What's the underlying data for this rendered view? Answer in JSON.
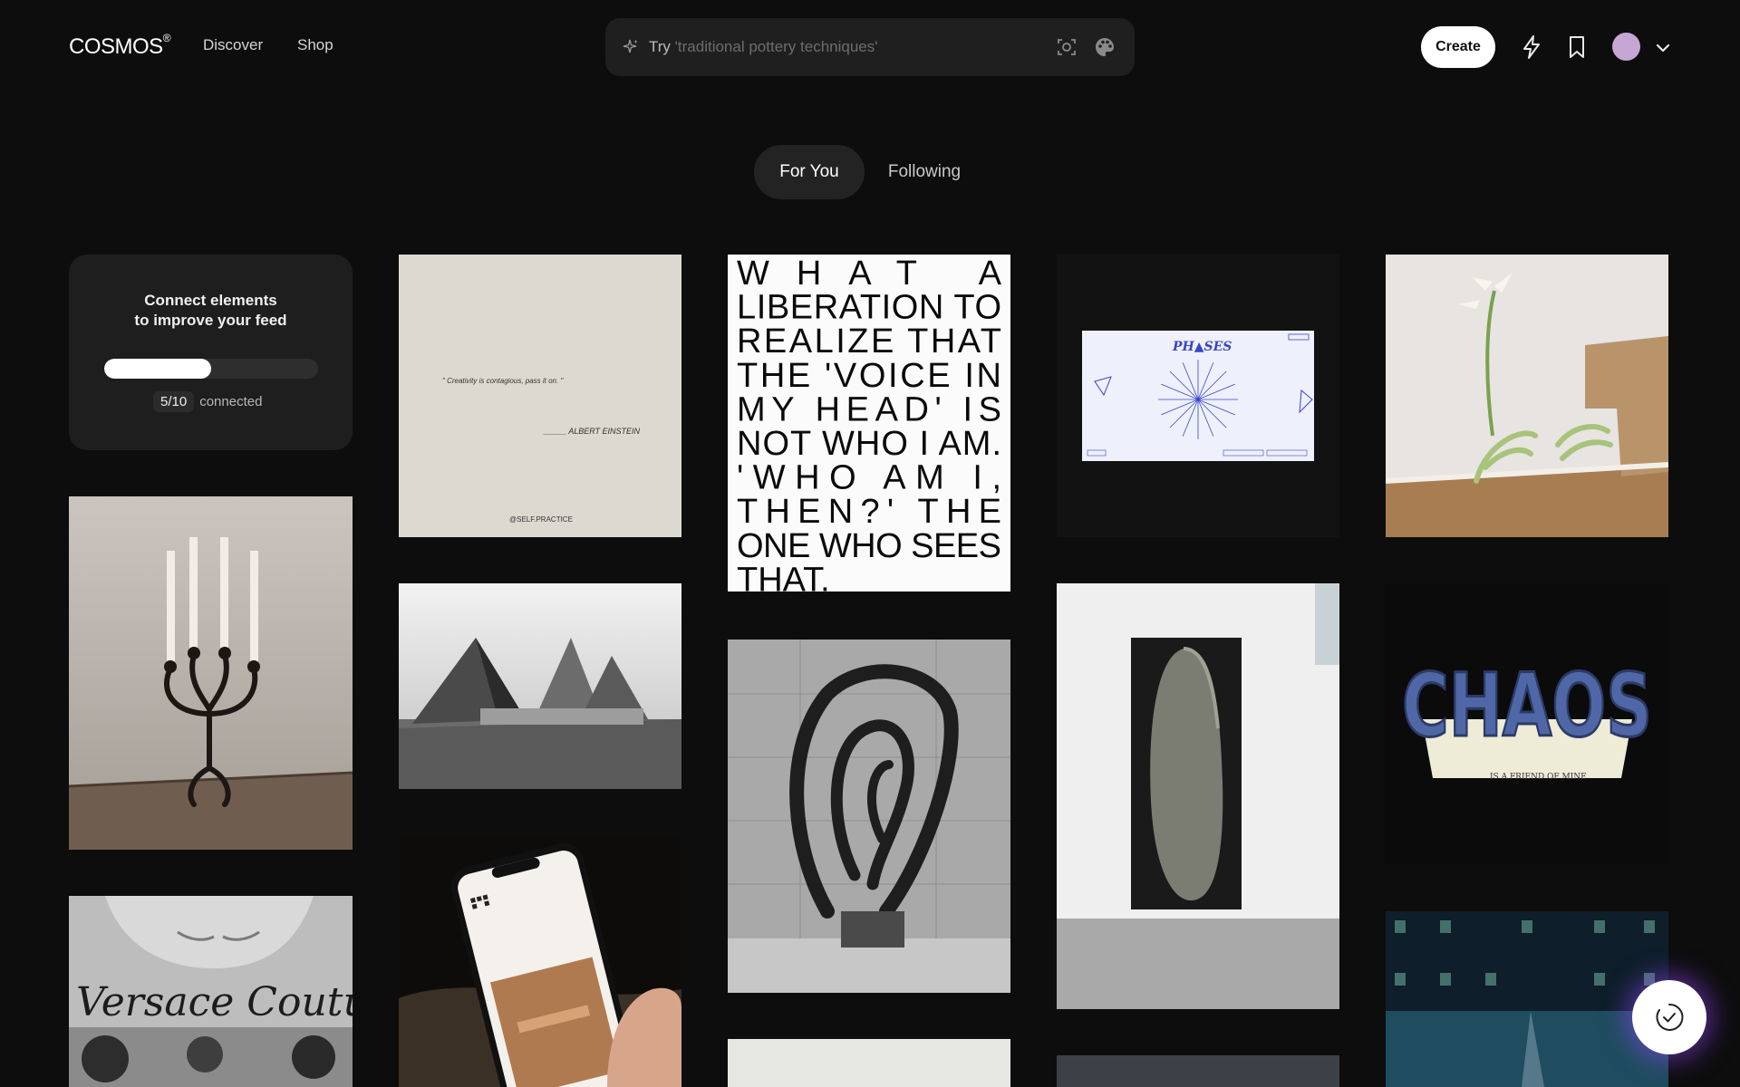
{
  "header": {
    "logo": "COSMOS",
    "logo_mark": "®",
    "nav": [
      {
        "label": "Discover"
      },
      {
        "label": "Shop"
      }
    ],
    "search": {
      "prefix": "Try",
      "hint": "'traditional pottery techniques'"
    },
    "create_label": "Create",
    "icons": [
      "sparkle-icon",
      "scan-icon",
      "palette-icon",
      "bolt-icon",
      "bookmark-icon",
      "chevron-down-icon"
    ]
  },
  "tabs": [
    {
      "label": "For You",
      "active": true
    },
    {
      "label": "Following",
      "active": false
    }
  ],
  "connect": {
    "title": "Connect elements\nto improve your feed",
    "count": "5/10",
    "status": "connected",
    "progress": 0.5
  },
  "tiles": {
    "quote": {
      "text": "\" Creativity is contagious, pass it on. \"",
      "author": "_____ ALBERT EINSTEIN",
      "handle": "@SELF.PRACTICE"
    },
    "text_poster": {
      "lines": [
        "WHAT          A",
        "LIBERATION  TO",
        "REALIZE   THAT",
        "THE 'VOICE  IN",
        "MY   HEAD'   IS",
        "NOT WHO I AM.",
        "'WHO   AM   I,",
        "THEN?'    THE",
        "ONE WHO SEES",
        "THAT."
      ]
    },
    "phases": {
      "title": "PH▲SES"
    },
    "chaos": {
      "title": "CHAOS",
      "subtitle": "IS A FRIEND OF MINE"
    },
    "versace": {
      "text": "Versace Couture"
    }
  },
  "colors": {
    "background": "#0d0d0d",
    "card": "#1e1e1e",
    "accent_glow": "#9646ff",
    "avatar": "#c6a6d4"
  }
}
